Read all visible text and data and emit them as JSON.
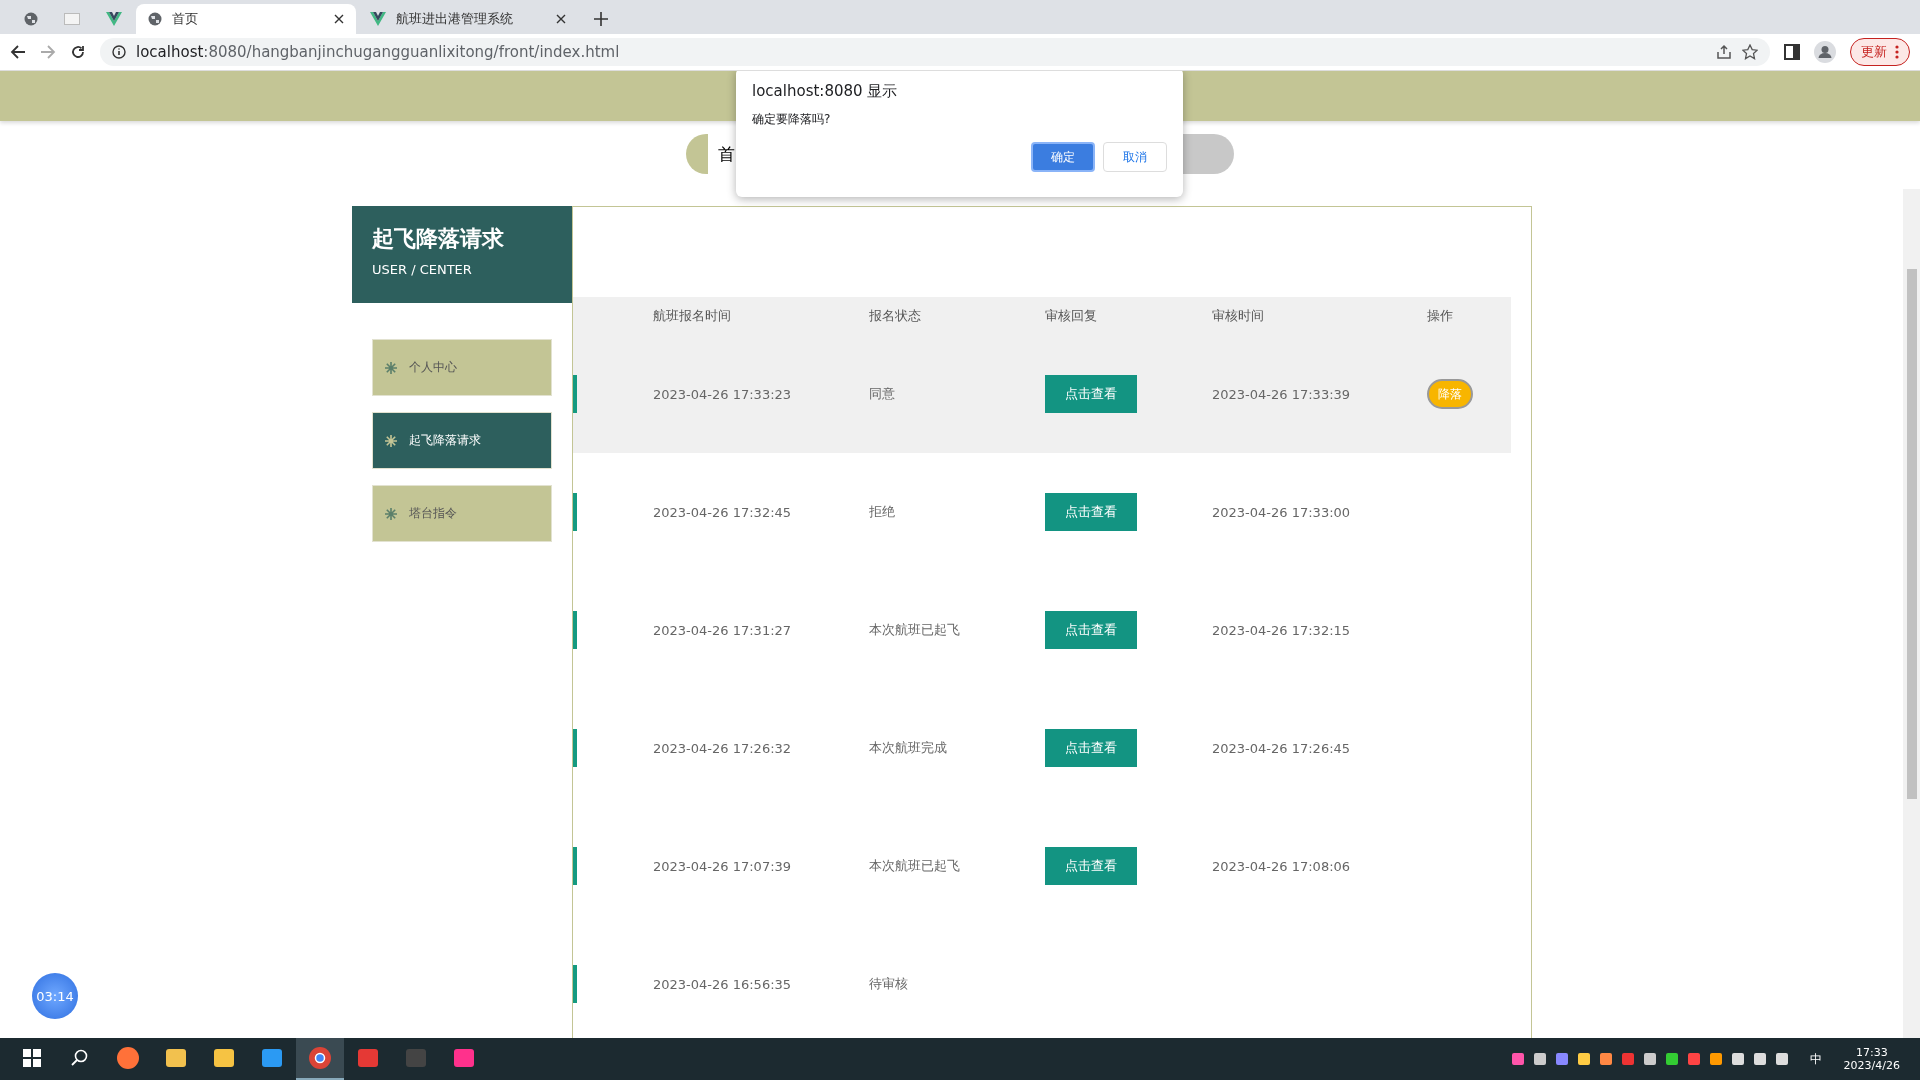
{
  "browser": {
    "tabs": [
      {
        "kind": "pinned",
        "selected": false
      },
      {
        "kind": "pinned",
        "selected": false
      },
      {
        "kind": "pinned",
        "selected": false
      },
      {
        "kind": "tab",
        "title": "首页",
        "selected": true
      },
      {
        "kind": "tab",
        "title": "航班进出港管理系统",
        "selected": false
      }
    ],
    "url_host": "localhost",
    "url_rest": ":8080/hangbanjinchugangguanlixitong/front/index.html",
    "update_button": "更新"
  },
  "nav": {
    "visible_text": "首"
  },
  "sidebar": {
    "title": "起飞降落请求",
    "subtitle": "USER / CENTER",
    "items": [
      {
        "label": "个人中心",
        "selected": false
      },
      {
        "label": "起飞降落请求",
        "selected": true
      },
      {
        "label": "塔台指令",
        "selected": false
      }
    ]
  },
  "table": {
    "columns": [
      "航班报名时间",
      "报名状态",
      "审核回复",
      "审核时间",
      "操作"
    ],
    "rows": [
      {
        "signup_time": "2023-04-26 17:33:23",
        "status": "同意",
        "reply_button": "点击查看",
        "review_time": "2023-04-26 17:33:39",
        "action": "降落",
        "selected": true
      },
      {
        "signup_time": "2023-04-26 17:32:45",
        "status": "拒绝",
        "reply_button": "点击查看",
        "review_time": "2023-04-26 17:33:00",
        "selected": false
      },
      {
        "signup_time": "2023-04-26 17:31:27",
        "status": "本次航班已起飞",
        "reply_button": "点击查看",
        "review_time": "2023-04-26 17:32:15",
        "selected": false
      },
      {
        "signup_time": "2023-04-26 17:26:32",
        "status": "本次航班完成",
        "reply_button": "点击查看",
        "review_time": "2023-04-26 17:26:45",
        "selected": false
      },
      {
        "signup_time": "2023-04-26 17:07:39",
        "status": "本次航班已起飞",
        "reply_button": "点击查看",
        "review_time": "2023-04-26 17:08:06",
        "selected": false
      },
      {
        "signup_time": "2023-04-26 16:56:35",
        "status": "待审核",
        "selected": false
      }
    ]
  },
  "timer": "03:14",
  "dialog": {
    "title": "localhost:8080 显示",
    "message": "确定要降落吗?",
    "ok": "确定",
    "cancel": "取消"
  },
  "taskbar": {
    "apps": [
      {
        "kind": "firefox",
        "selected": false
      },
      {
        "kind": "paint",
        "selected": false
      },
      {
        "kind": "folder",
        "selected": false
      },
      {
        "kind": "vscode",
        "selected": false
      },
      {
        "kind": "chrome",
        "selected": true
      },
      {
        "kind": "wps",
        "selected": false
      },
      {
        "kind": "terminal",
        "selected": false
      },
      {
        "kind": "idea",
        "selected": false
      }
    ],
    "ime": "中",
    "time": "17:33",
    "date": "2023/4/26"
  }
}
